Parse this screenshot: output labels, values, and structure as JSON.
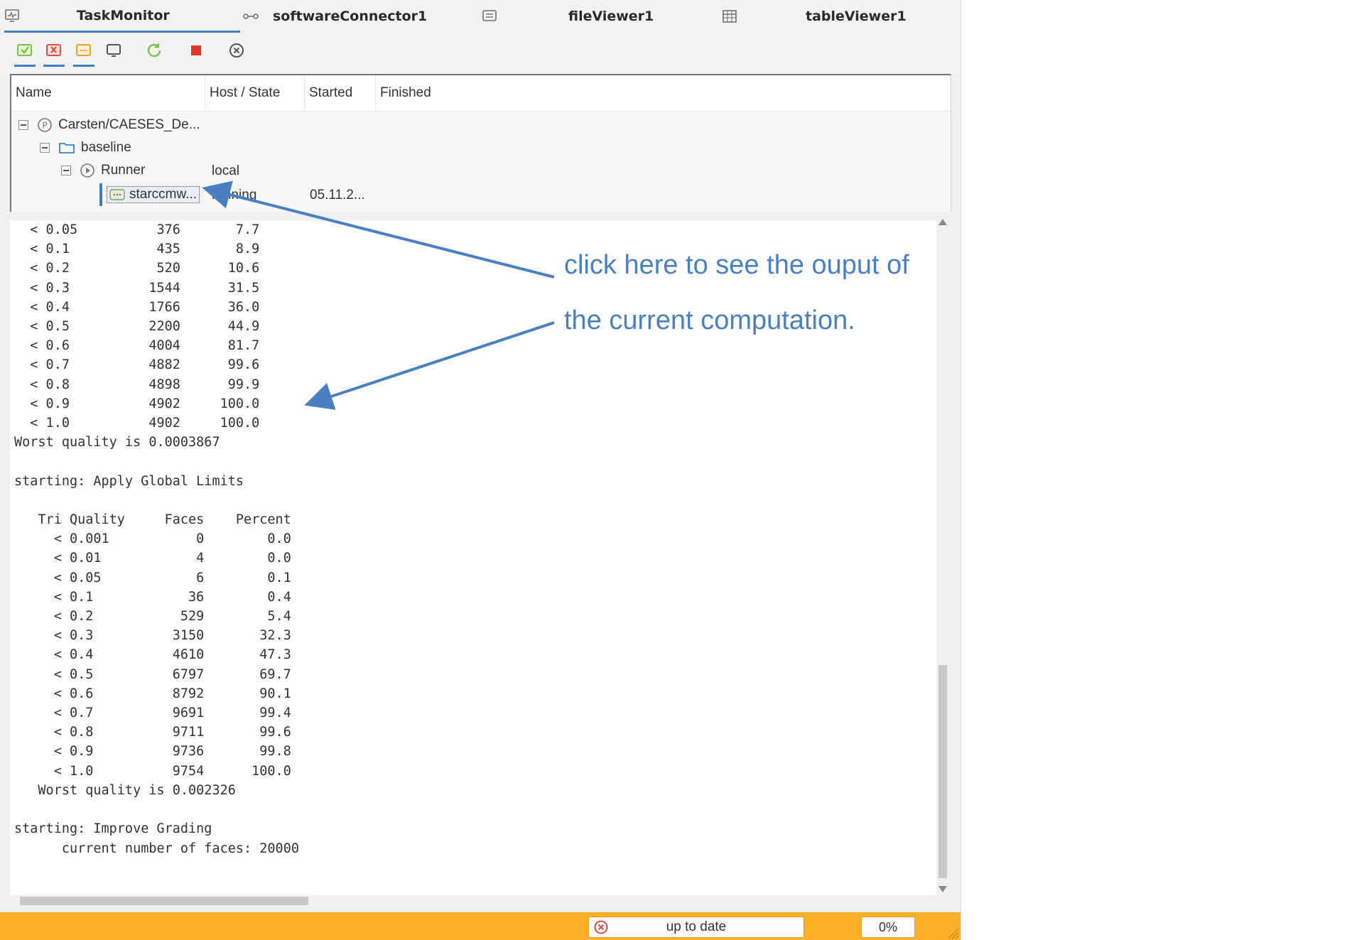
{
  "tabs": [
    {
      "label": "TaskMonitor",
      "icon": "monitor-icon"
    },
    {
      "label": "softwareConnector1",
      "icon": "connector-icon"
    },
    {
      "label": "fileViewer1",
      "icon": "file-viewer-icon"
    },
    {
      "label": "tableViewer1",
      "icon": "table-icon"
    }
  ],
  "toolbar": {
    "buttons": [
      {
        "name": "show-finished-icon",
        "color": "#7ac143"
      },
      {
        "name": "show-failed-icon",
        "color": "#e04a3a"
      },
      {
        "name": "show-running-icon",
        "color": "#f0a020"
      },
      {
        "name": "monitor-icon",
        "color": "#555555"
      },
      {
        "name": "refresh-icon",
        "color": "#7ac143"
      },
      {
        "name": "stop-icon",
        "color": "#e0362b"
      },
      {
        "name": "close-circle-icon",
        "color": "#555555"
      }
    ]
  },
  "tree": {
    "columns": [
      "Name",
      "Host / State",
      "Started",
      "Finished"
    ],
    "rows": [
      {
        "name": "Carsten/CAESES_De...",
        "icon": "project-icon",
        "host": "",
        "started": ""
      },
      {
        "name": "baseline",
        "icon": "folder-icon",
        "host": "",
        "started": ""
      },
      {
        "name": "Runner",
        "icon": "play-icon",
        "host": "local",
        "started": ""
      },
      {
        "name": "starccmw...",
        "icon": "task-icon",
        "host": "running",
        "started": "05.11.2..."
      }
    ]
  },
  "console": {
    "text": "  < 0.05          376       7.7\n  < 0.1           435       8.9\n  < 0.2           520      10.6\n  < 0.3          1544      31.5\n  < 0.4          1766      36.0\n  < 0.5          2200      44.9\n  < 0.6          4004      81.7\n  < 0.7          4882      99.6\n  < 0.8          4898      99.9\n  < 0.9          4902     100.0\n  < 1.0          4902     100.0\nWorst quality is 0.0003867\n\nstarting: Apply Global Limits\n\n   Tri Quality     Faces    Percent\n     < 0.001           0        0.0\n     < 0.01            4        0.0\n     < 0.05            6        0.1\n     < 0.1            36        0.4\n     < 0.2           529        5.4\n     < 0.3          3150       32.3\n     < 0.4          4610       47.3\n     < 0.5          6797       69.7\n     < 0.6          8792       90.1\n     < 0.7          9691       99.4\n     < 0.8          9711       99.6\n     < 0.9          9736       99.8\n     < 1.0          9754      100.0\n   Worst quality is 0.002326\n\nstarting: Improve Grading\n      current number of faces: 20000"
  },
  "statusbar": {
    "status": "up to date",
    "status_icon": "error-circle-icon",
    "progress": "0%",
    "bg_color": "#fbb026"
  },
  "annotation": {
    "line1": "click here to see the ouput of",
    "line2": "the current computation.",
    "color": "#4a7fc1"
  }
}
